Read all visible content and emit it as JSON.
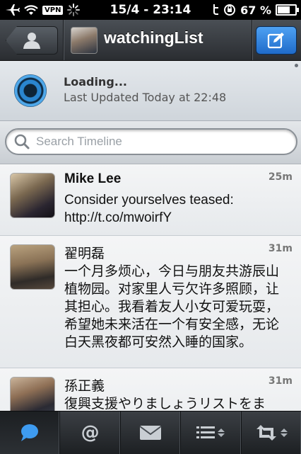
{
  "status_bar": {
    "vpn": "VPN",
    "datetime": "15/4 - 23:14",
    "battery": "67 %",
    "battery_level": 0.67
  },
  "nav": {
    "title": "watchingList"
  },
  "loading": {
    "title": "Loading...",
    "subtitle": "Last Updated Today at 22:48"
  },
  "search": {
    "placeholder": "Search Timeline"
  },
  "tweets": [
    {
      "name": "Mike Lee",
      "time": "25m",
      "text": "Consider yourselves teased: http://t.co/mwoirfY"
    },
    {
      "name": "翟明磊",
      "time": "31m",
      "text": "一个月多烦心，今日与朋友共游辰山植物园。对家里人亏欠许多照顾，让其担心。我看着友人小女可爱玩耍，希望她未来活在一个有安全感，无论白天黑夜都可安然入睡的国家。"
    },
    {
      "name": "孫正義",
      "time": "31m",
      "text": "復興支援やりましょうリストをま"
    }
  ],
  "tabs": [
    {
      "icon": "timeline-bubble-icon",
      "active": true
    },
    {
      "icon": "mentions-at-icon",
      "active": false
    },
    {
      "icon": "messages-envelope-icon",
      "active": false
    },
    {
      "icon": "lists-icon",
      "active": false
    },
    {
      "icon": "retweets-icon",
      "active": false
    }
  ],
  "colors": {
    "accent": "#2f86e0",
    "navbar": "#3a3e43"
  }
}
